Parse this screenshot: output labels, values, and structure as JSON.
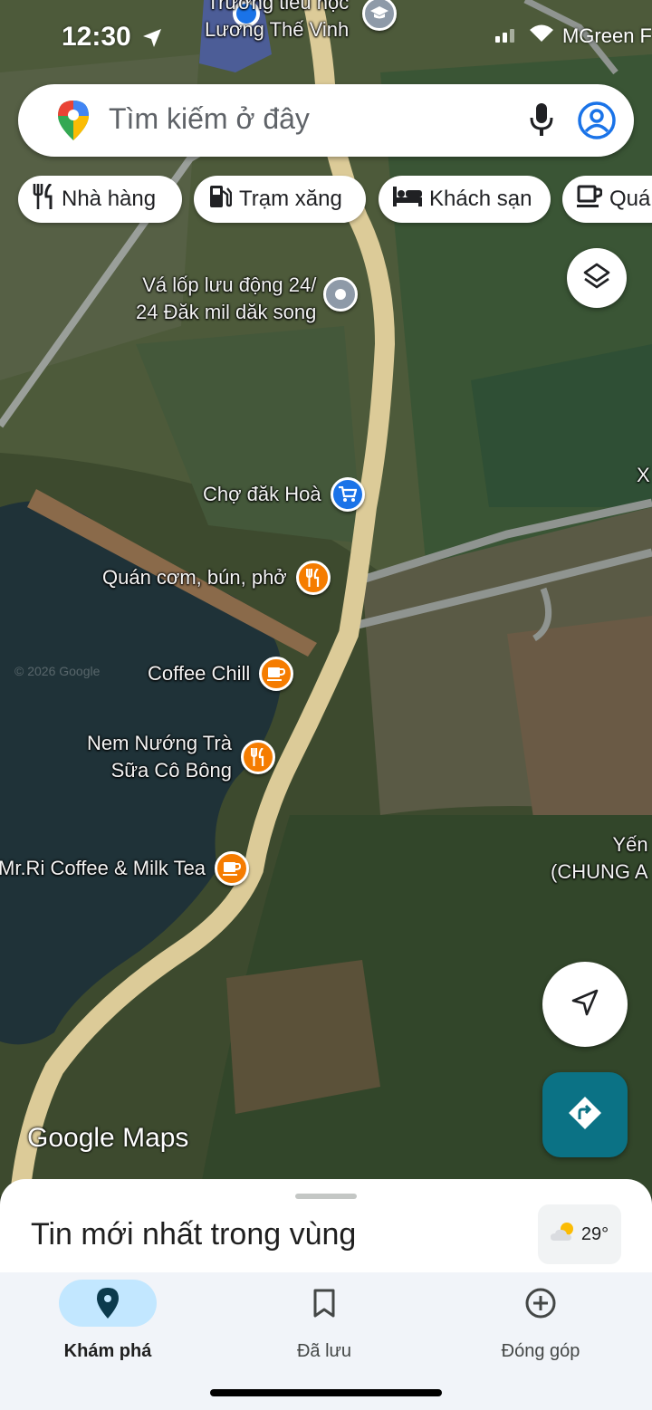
{
  "status_bar": {
    "time": "12:30",
    "carrier": "MGreen F"
  },
  "search": {
    "placeholder": "Tìm kiếm ở đây"
  },
  "chips": [
    {
      "label": "Nhà hàng",
      "icon": "restaurant-icon"
    },
    {
      "label": "Trạm xăng",
      "icon": "gas-station-icon"
    },
    {
      "label": "Khách sạn",
      "icon": "hotel-icon"
    },
    {
      "label": "Quá",
      "icon": "coffee-icon"
    }
  ],
  "map": {
    "top_label": "Trường tiểu học\nLương Thế Vinh",
    "pois": [
      {
        "name": "Vá lốp lưu động 24/\n24 Đăk mil dăk song",
        "icon": "location-pin-icon",
        "color": "#8e9aa8"
      },
      {
        "name": "Chợ đăk Hoà",
        "icon": "shopping-cart-icon",
        "color": "#1a73e8"
      },
      {
        "name": "Quán cơm, bún, phở",
        "icon": "restaurant-icon",
        "color": "#f57c00"
      },
      {
        "name": "Coffee Chill",
        "icon": "coffee-icon",
        "color": "#f57c00"
      },
      {
        "name": "Nem Nướng Trà\nSữa Cô Bông",
        "icon": "restaurant-icon",
        "color": "#f57c00"
      },
      {
        "name": "Mr.Ri Coffee & Milk Tea",
        "icon": "coffee-icon",
        "color": "#f57c00"
      }
    ],
    "edge_label_top": "X",
    "edge_label": "Yến\n(CHUNG A",
    "logo": "Google Maps",
    "copyright": "© 2026 Google"
  },
  "sheet": {
    "title": "Tin mới nhất trong vùng",
    "temperature": "29°"
  },
  "nav": [
    {
      "label": "Khám phá",
      "icon": "explore-pin-icon",
      "active": true
    },
    {
      "label": "Đã lưu",
      "icon": "bookmark-icon",
      "active": false
    },
    {
      "label": "Đóng góp",
      "icon": "add-circle-icon",
      "active": false
    }
  ],
  "colors": {
    "accent": "#1a73e8",
    "poi_orange": "#f57c00",
    "directions_fab": "#0b7285",
    "nav_active": "#c2e7ff"
  }
}
